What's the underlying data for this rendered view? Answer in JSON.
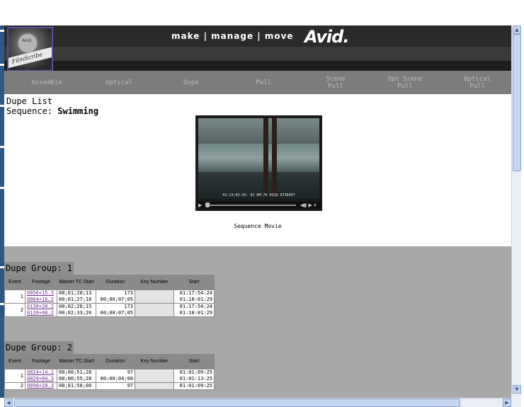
{
  "header": {
    "tagline": "make | manage | move",
    "brand": "Avid.",
    "logo_text": "FilmScribe"
  },
  "nav": {
    "items": [
      {
        "line1": "Assemble",
        "line2": ""
      },
      {
        "line1": "Optical",
        "line2": ""
      },
      {
        "line1": "Dupe",
        "line2": ""
      },
      {
        "line1": "Pull",
        "line2": ""
      },
      {
        "line1": "Scene",
        "line2": "Pull"
      },
      {
        "line1": "Opt Scene",
        "line2": "Pull"
      },
      {
        "line1": "Optical",
        "line2": "Pull"
      }
    ]
  },
  "report": {
    "title": "Dupe List",
    "sequence_label": "Sequence:",
    "sequence_name": "Swimming",
    "movie_label": "Sequence Movie",
    "movie_timecode": "01:13:03:26: 01      KM.70 0316 9736407"
  },
  "columns": [
    "Event",
    "Footage",
    "Master TC Start",
    "Duration",
    "Key Number",
    "Start"
  ],
  "groups": [
    {
      "title": "Dupe Group: 1",
      "rows": [
        {
          "event": "1",
          "footage": [
            "0056+15.3",
            "0064+16.2"
          ],
          "master": [
            "00;01;20;13",
            "00;01;27;18"
          ],
          "duration": [
            "173",
            "00;00;07;05"
          ],
          "key": "",
          "start": [
            "01:17:54:24",
            "01:18:01:29"
          ]
        },
        {
          "event": "2",
          "footage": [
            "0130+20.2",
            "0139+00.2"
          ],
          "master": [
            "00;02;26;15",
            "00;02;33;20"
          ],
          "duration": [
            "173",
            "00;00;07;05"
          ],
          "key": "",
          "start": [
            "01:17:54:24",
            "01:18:01:29"
          ]
        }
      ]
    },
    {
      "title": "Dupe Group: 2",
      "rows": [
        {
          "event": "1",
          "footage": [
            "0024+14.1",
            "0029+04.3"
          ],
          "master": [
            "00;00;51;28",
            "00;00;55;28"
          ],
          "duration": [
            "97",
            "00;00;04;00"
          ],
          "key": "",
          "start": [
            "01:01:09:25",
            "01:01:13:25"
          ]
        },
        {
          "event": "2",
          "footage": [
            "0098+20.3",
            ""
          ],
          "master": [
            "00;01;58;00",
            ""
          ],
          "duration": [
            "97",
            ""
          ],
          "key": "",
          "start": [
            "01:01:09:25",
            ""
          ]
        }
      ]
    }
  ]
}
